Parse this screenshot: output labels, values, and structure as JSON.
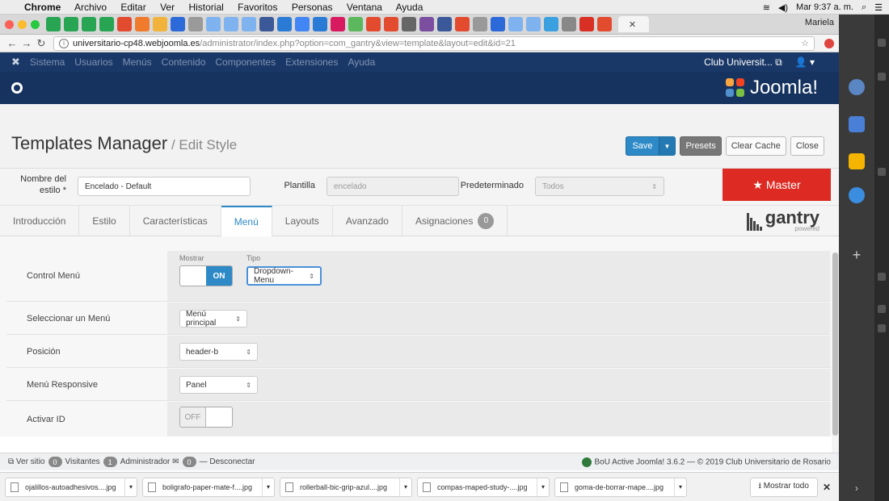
{
  "os_menu": {
    "apple": "",
    "app": "Chrome",
    "items": [
      "Archivo",
      "Editar",
      "Ver",
      "Historial",
      "Favoritos",
      "Personas",
      "Ventana",
      "Ayuda"
    ],
    "clock": "Mar 9:37 a. m."
  },
  "browser": {
    "profile": "Mariela",
    "active_tab_icon": "",
    "url_host": "universitario-cp48.webjoomla.es",
    "url_path": "/administrator/index.php?option=com_gantry&view=template&layout=edit&id=21"
  },
  "joomla_top": {
    "menu": [
      "Sistema",
      "Usuarios",
      "Menús",
      "Contenido",
      "Componentes",
      "Extensiones",
      "Ayuda"
    ],
    "site": "Club Universit... ⧉",
    "user_icon": "👤 ▾"
  },
  "brand": "Joomla!",
  "page": {
    "title": "Templates Manager",
    "subtitle": " / Edit Style"
  },
  "toolbar": {
    "save": "Save",
    "presets": "Presets",
    "clear_cache": "Clear Cache",
    "close": "Close"
  },
  "form": {
    "name_label": "Nombre del estilo *",
    "name_value": "Encelado - Default",
    "template_label": "Plantilla",
    "template_value": "encelado",
    "default_label": "Predeterminado",
    "default_value": "Todos",
    "master": "★ Master"
  },
  "tabs": [
    "Introducción",
    "Estilo",
    "Características",
    "Menú",
    "Layouts",
    "Avanzado",
    "Asignaciones"
  ],
  "tab_badge": "0",
  "gantry": {
    "word": "gantry",
    "sub": "powered"
  },
  "settings": {
    "control_label": "Control Menú",
    "show_label": "Mostrar",
    "type_label": "Tipo",
    "toggle_on": "ON",
    "menu_type": "Dropdown-Menu",
    "select_label": "Seleccionar un Menú",
    "select_value": "Menú principal",
    "position_label": "Posición",
    "position_value": "header-b",
    "responsive_label": "Menú Responsive",
    "responsive_value": "Panel",
    "activar_label": "Activar ID",
    "toggle_off": "OFF"
  },
  "status": {
    "view_site": "Ver sitio",
    "visitors_count": "0",
    "visitors": "Visitantes",
    "admin_count": "1",
    "admin": "Administrador",
    "mail_count": "0",
    "logout": "Desconectar",
    "right": "BoU Active Joomla! 3.6.2  —  © 2019 Club Universitario de Rosario"
  },
  "downloads": {
    "files": [
      "ojalillos-autoadhesivos....jpg",
      "boligrafo-paper-mate-f....jpg",
      "rollerball-bic-grip-azul....jpg",
      "compas-maped-study-....jpg",
      "goma-de-borrar-mape....jpg"
    ],
    "show_all": "⭳  Mostrar todo",
    "close": "✕"
  },
  "colors": {
    "joomla_blue": "#1a3867",
    "accent": "#2d8ac7",
    "master_red": "#dd2a22"
  }
}
